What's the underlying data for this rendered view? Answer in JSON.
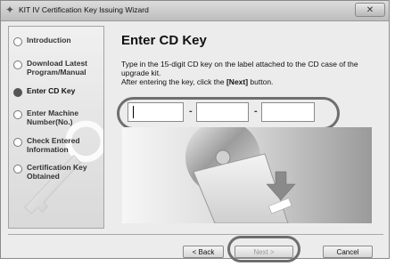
{
  "window": {
    "title": "KIT IV Certification Key Issuing Wizard",
    "close_label": "✕"
  },
  "sidebar": {
    "steps": [
      {
        "label_1": "Introduction",
        "label_2": "",
        "state": "inactive"
      },
      {
        "label_1": "Download Latest",
        "label_2": "Program/Manual",
        "state": "inactive"
      },
      {
        "label_1": "Enter CD Key",
        "label_2": "",
        "state": "active"
      },
      {
        "label_1": "Enter Machine",
        "label_2": "Number(No.)",
        "state": "inactive"
      },
      {
        "label_1": "Check Entered",
        "label_2": "Information",
        "state": "inactive"
      },
      {
        "label_1": "Certification Key",
        "label_2": "Obtained",
        "state": "inactive"
      }
    ]
  },
  "main": {
    "heading": "Enter CD Key",
    "instruction_line1": "Type in the 15-digit CD key on the label attached to the CD case of the",
    "instruction_line2": "upgrade kit.",
    "instruction_line3_pre": "After entering the key, click the ",
    "instruction_line3_bold": "[Next]",
    "instruction_line3_post": " button.",
    "key_fields": [
      {
        "value": "",
        "placeholder": ""
      },
      {
        "value": "",
        "placeholder": ""
      },
      {
        "value": "",
        "placeholder": ""
      }
    ],
    "separator": "-"
  },
  "buttons": {
    "back": "< Back",
    "next": "Next >",
    "cancel": "Cancel",
    "next_enabled": false
  },
  "colors": {
    "highlight_oval": "#6e6e6e",
    "active_step": "#555555"
  }
}
